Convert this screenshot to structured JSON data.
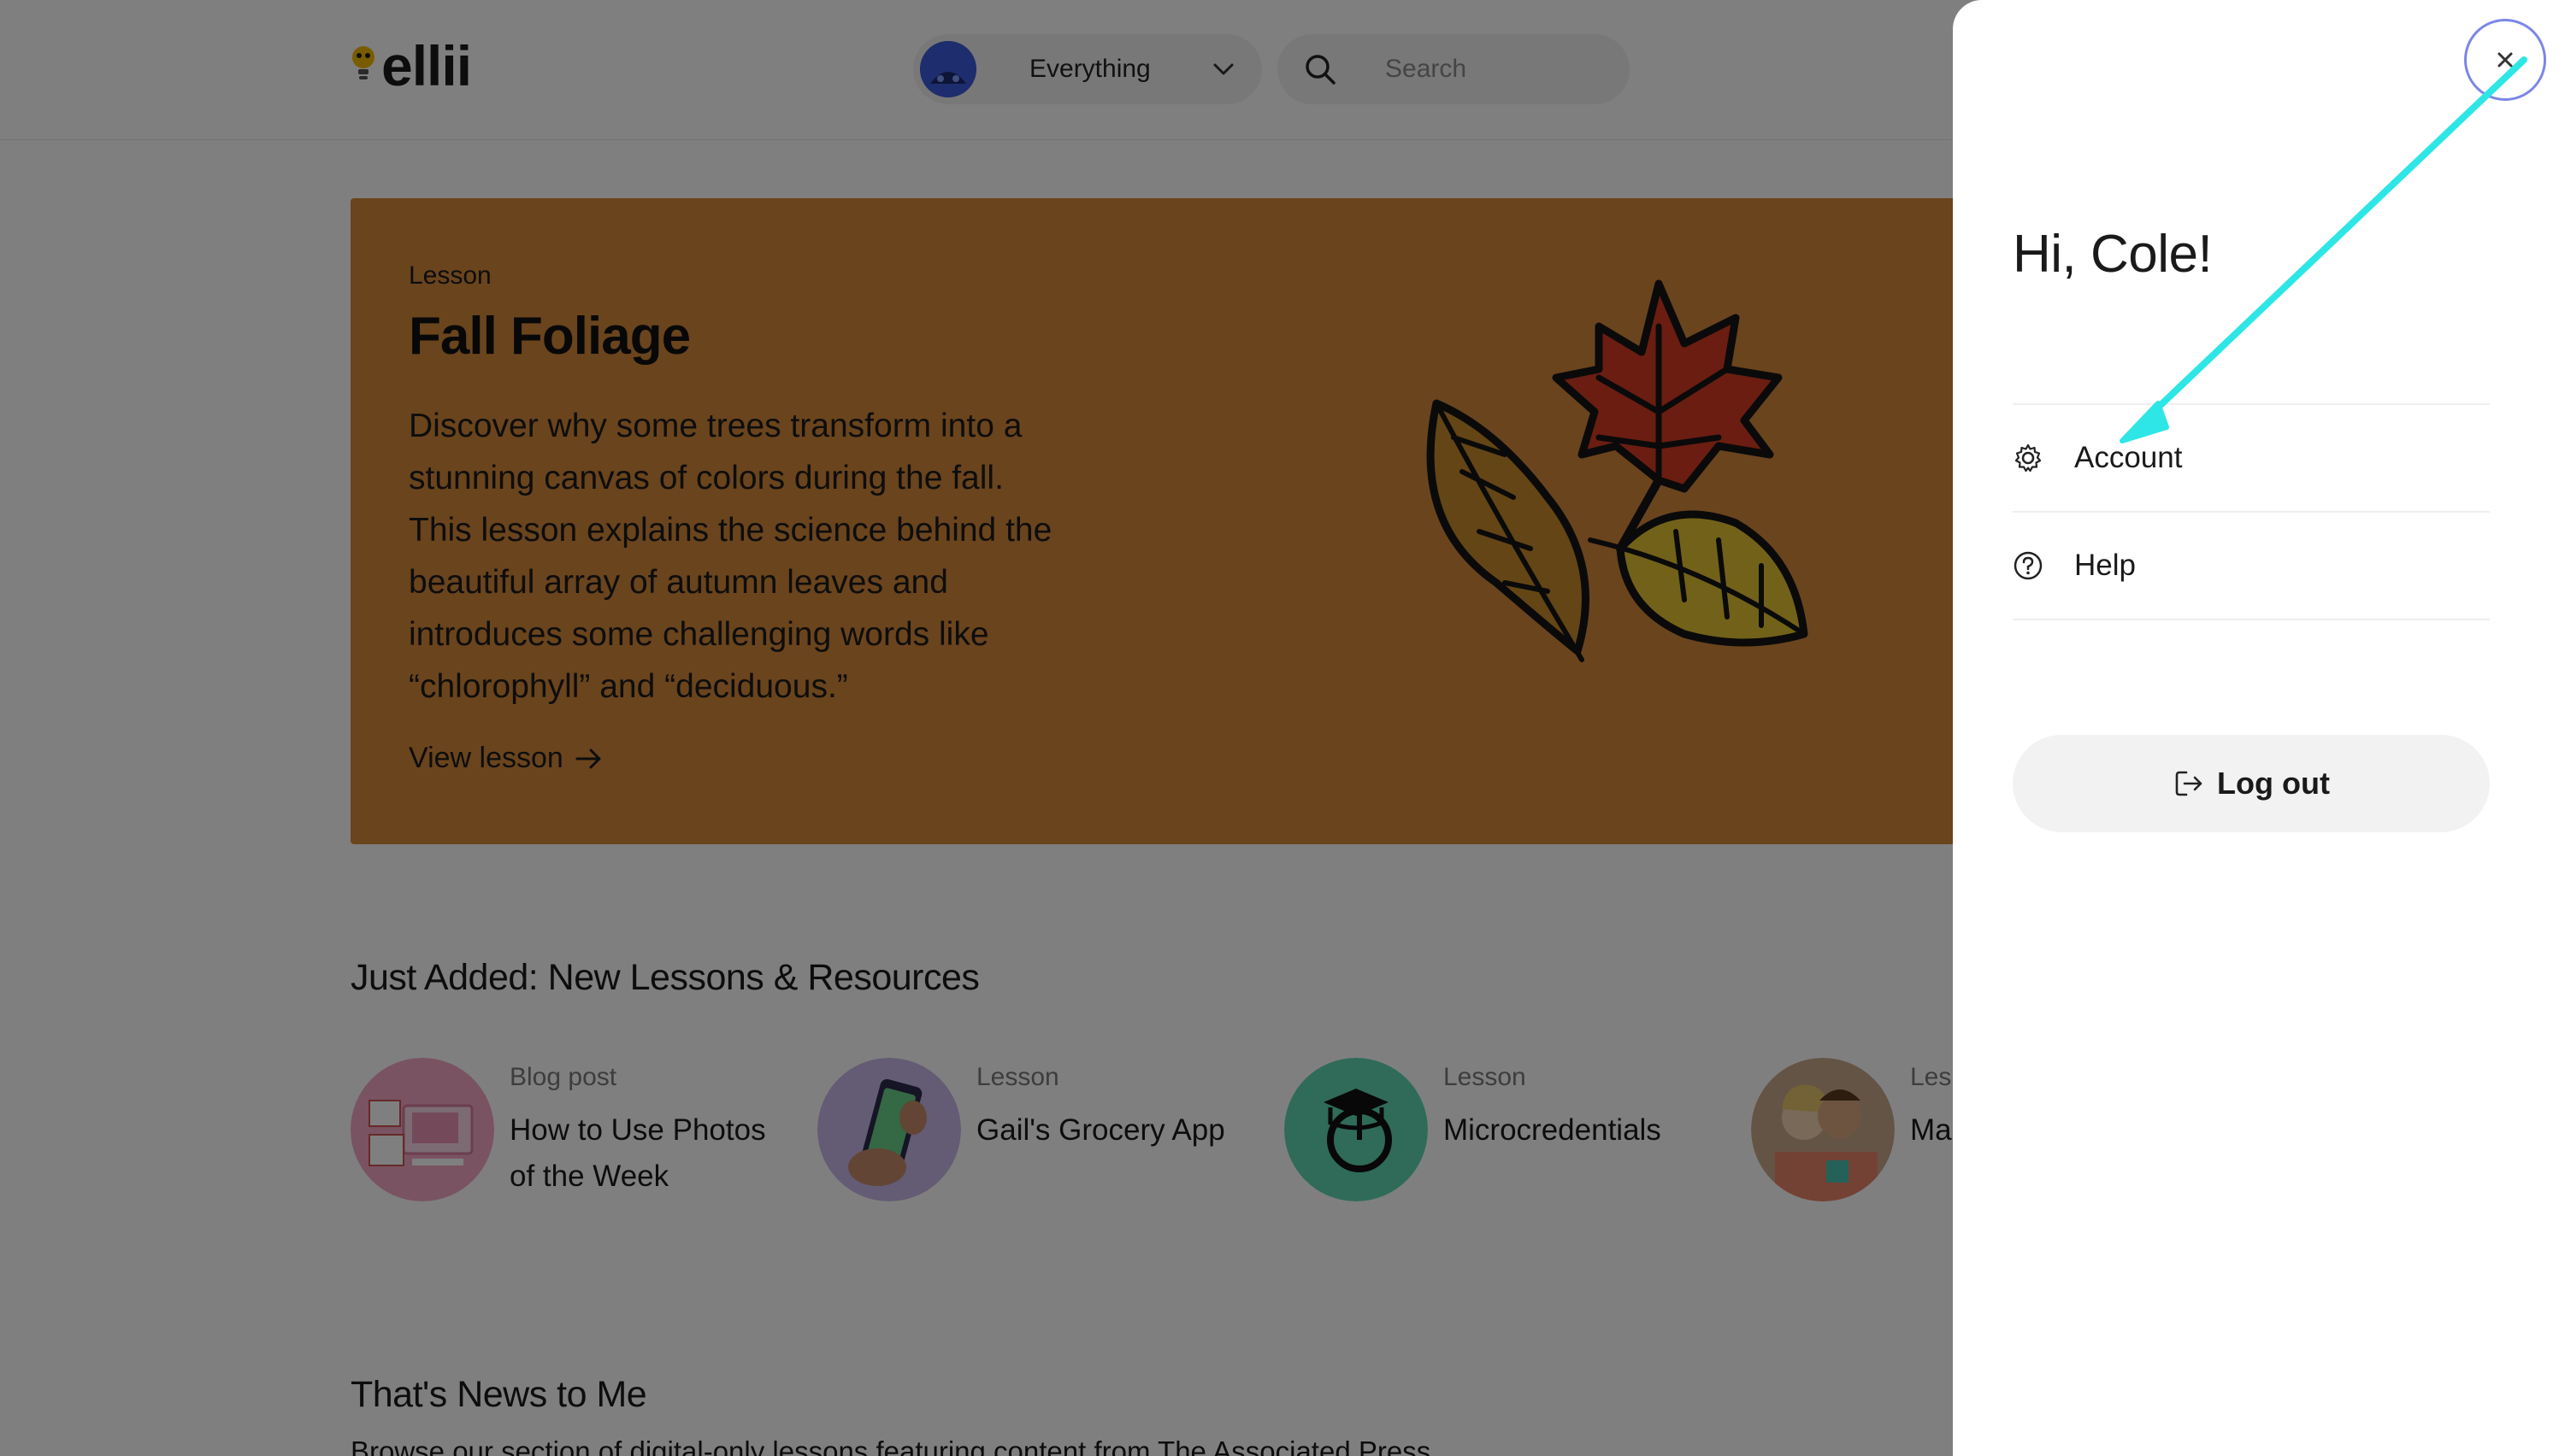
{
  "header": {
    "logo_text": "ellii",
    "filter": {
      "selected": "Everything"
    },
    "search": {
      "placeholder": "Search"
    }
  },
  "hero": {
    "eyebrow": "Lesson",
    "title": "Fall Foliage",
    "description": "Discover why some trees transform into a stunning canvas of colors during the fall. This lesson explains the science behind the beautiful array of autumn leaves and introduces some challenging words like “chlorophyll” and “deciduous.”",
    "link_label": "View lesson",
    "bg_color": "#d4883a"
  },
  "just_added": {
    "title": "Just Added: New Lessons & Resources",
    "items": [
      {
        "type": "Blog post",
        "title": "How to Use Photos of the Week",
        "thumb_color": "#f2a7c3"
      },
      {
        "type": "Lesson",
        "title": "Gail's Grocery App",
        "thumb_color": "#c9b7e8"
      },
      {
        "type": "Lesson",
        "title": "Microcredentials",
        "thumb_color": "#5fd6b0"
      },
      {
        "type": "Les",
        "title": "Ma",
        "thumb_color": "#c8a98a"
      }
    ]
  },
  "news": {
    "title": "That's News to Me",
    "description": "Browse our section of digital-only lessons featuring content from The Associated Press."
  },
  "drawer": {
    "greeting": "Hi, Cole!",
    "menu": [
      {
        "label": "Account",
        "icon": "gear-icon"
      },
      {
        "label": "Help",
        "icon": "question-circle-icon"
      }
    ],
    "logout_label": "Log out",
    "close_icon": "close-icon"
  },
  "annotation": {
    "color": "#2ee6e6"
  }
}
